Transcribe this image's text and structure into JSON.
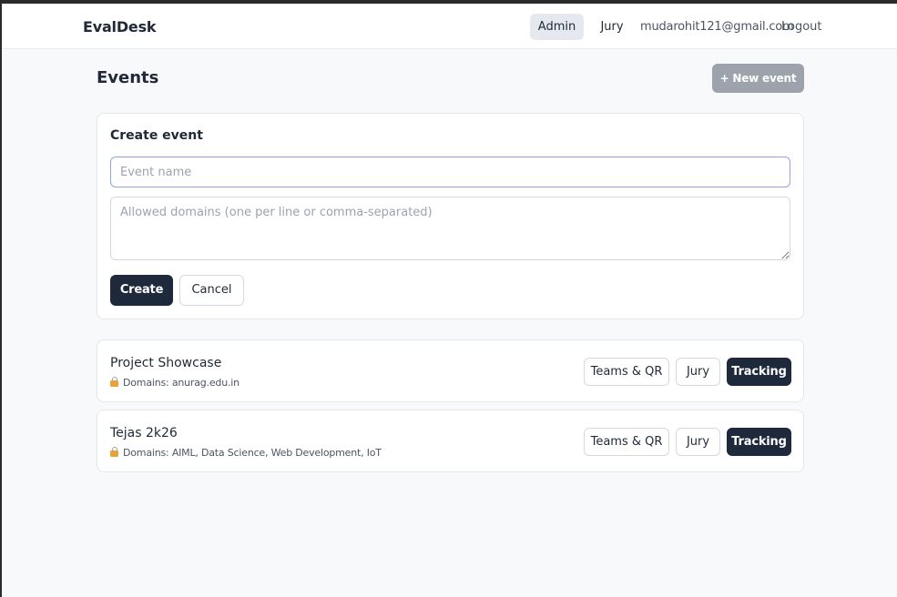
{
  "navbar": {
    "brand": "EvalDesk",
    "admin_label": "Admin",
    "jury_label": "Jury",
    "user_email": "mudarohit121@gmail.com",
    "logout_label": "Logout"
  },
  "page": {
    "title": "Events",
    "new_event_label": "+ New event"
  },
  "create_form": {
    "title": "Create event",
    "name_value": "",
    "name_placeholder": "Event name",
    "domains_value": "",
    "domains_placeholder": "Allowed domains (one per line or comma-separated)",
    "create_label": "Create",
    "cancel_label": "Cancel"
  },
  "events": [
    {
      "name": "Project Showcase",
      "domains": "Domains: anurag.edu.in",
      "teams_label": "Teams & QR",
      "jury_label": "Jury",
      "tracking_label": "Tracking"
    },
    {
      "name": "Tejas 2k26",
      "domains": "Domains: AIML, Data Science, Web Development, IoT",
      "teams_label": "Teams & QR",
      "jury_label": "Jury",
      "tracking_label": "Tracking"
    }
  ],
  "icons": {
    "domain_icon": "lock-icon"
  },
  "colors": {
    "primary_dark": "#1e293b",
    "disabled_button": "#9ca3ab",
    "focus_border": "#8fa6d6",
    "lock_body": "#e9a23b"
  }
}
